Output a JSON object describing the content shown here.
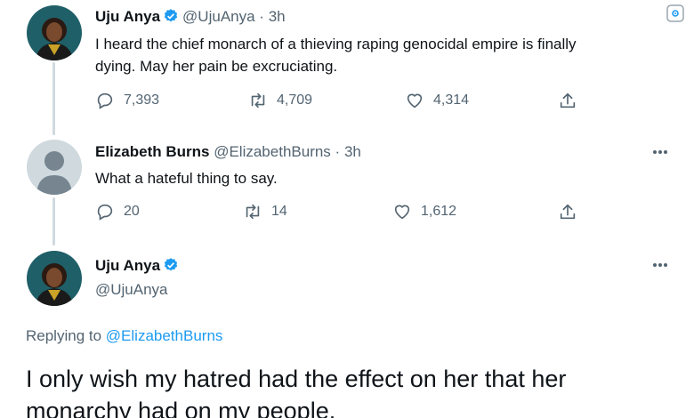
{
  "tweet1": {
    "author_name": "Uju Anya",
    "author_handle": "@UjuAnya",
    "dot": "·",
    "time": "3h",
    "text_line1": "I heard the chief monarch of a thieving raping genocidal empire is finally",
    "text_line2": "dying. May her pain be excruciating.",
    "replies": "7,393",
    "retweets": "4,709",
    "likes": "4,314"
  },
  "tweet2": {
    "author_name": "Elizabeth Burns",
    "author_handle": "@ElizabethBurns",
    "dot": "·",
    "time": "3h",
    "text": "What a hateful thing to say.",
    "replies": "20",
    "retweets": "14",
    "likes": "1,612"
  },
  "tweet3": {
    "author_name": "Uju Anya",
    "author_handle": "@UjuAnya",
    "replying_prefix": "Replying to",
    "replying_to": "@ElizabethBurns",
    "text_line1": "I only wish my hatred had the effect on her that her",
    "text_line2": "monarchy had on my people."
  },
  "colors": {
    "text_primary": "#0f1419",
    "text_secondary": "#536471",
    "link": "#1d9bf0",
    "verified": "#1d9bf0",
    "thread_line": "#cfd9de"
  },
  "icons": {
    "reply": "reply-icon",
    "retweet": "retweet-icon",
    "like": "heart-icon",
    "share": "share-icon",
    "more": "more-icon",
    "verified": "verified-badge-icon",
    "corner": "view-icon"
  }
}
